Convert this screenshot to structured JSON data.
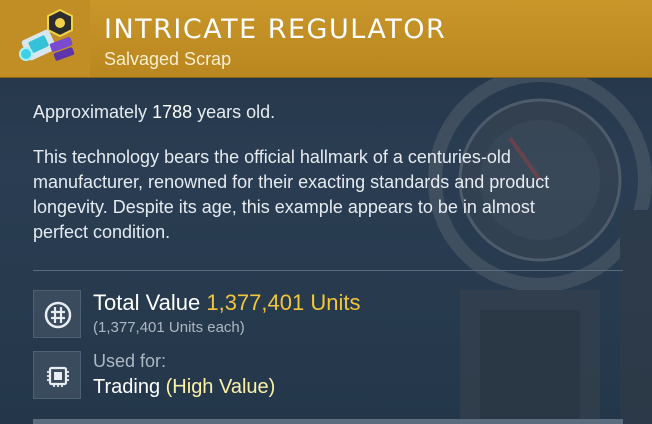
{
  "item": {
    "title": "INTRICATE REGULATOR",
    "category": "Salvaged Scrap",
    "icon": "regulator-item-icon"
  },
  "description": {
    "age_prefix": "Approximately",
    "age_years": "1788",
    "age_suffix": "years old.",
    "text": "This technology bears the official hallmark of a centuries-old manufacturer, renowned for their exacting standards and product longevity. Despite its age, this example appears to be in almost perfect condition."
  },
  "value": {
    "label": "Total Value",
    "amount": "1,377,401 Units",
    "each": "(1,377,401 Units each)",
    "icon": "units-currency-icon"
  },
  "usage": {
    "label": "Used for:",
    "use": "Trading",
    "qualifier": "(High Value)",
    "icon": "trade-chip-icon"
  },
  "colors": {
    "header": "#c9962a",
    "panel": "#2a3d52",
    "value_accent": "#f2c63a",
    "qualifier_accent": "#fbf2a8"
  }
}
